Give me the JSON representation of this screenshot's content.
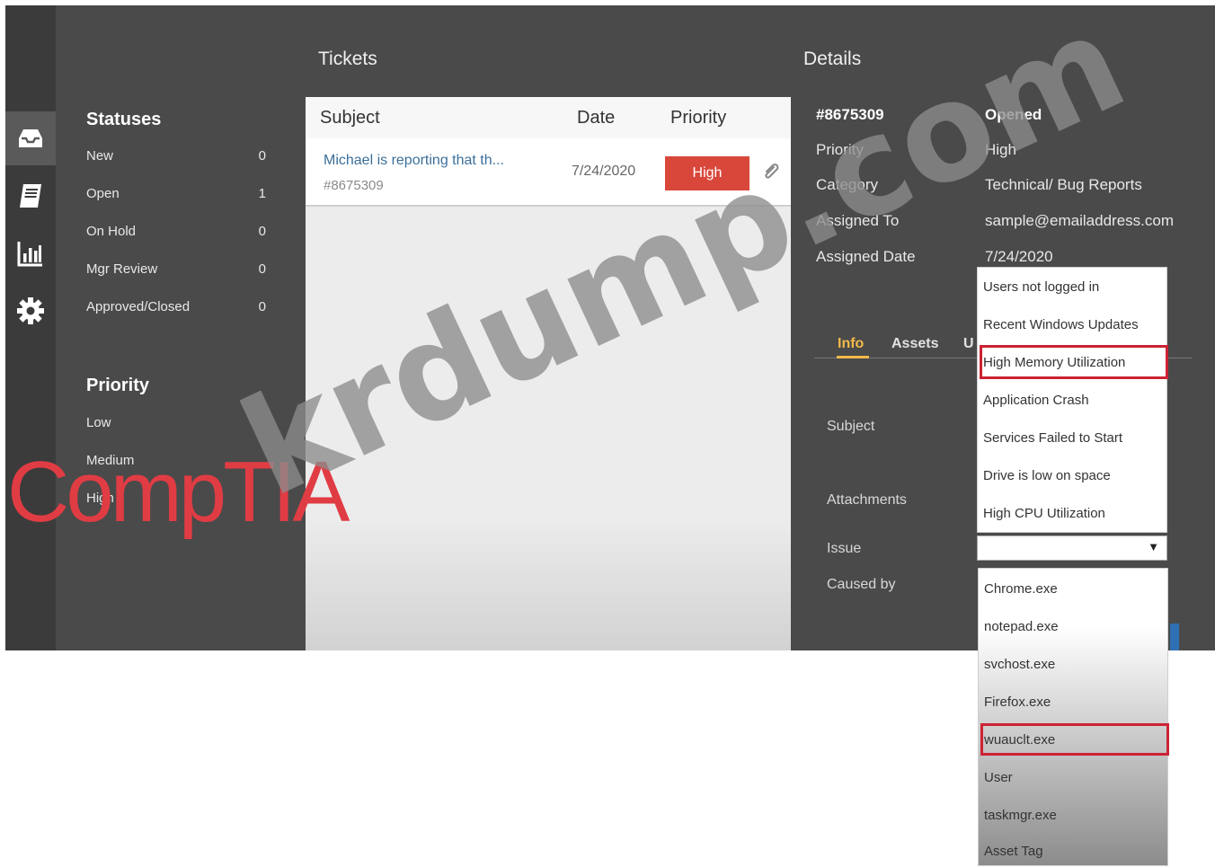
{
  "sidebar": {
    "icons": [
      "inbox-icon",
      "book-icon",
      "chart-icon",
      "gear-icon"
    ],
    "statuses_heading": "Statuses",
    "statuses": [
      {
        "label": "New",
        "count": "0"
      },
      {
        "label": "Open",
        "count": "1"
      },
      {
        "label": "On Hold",
        "count": "0"
      },
      {
        "label": "Mgr Review",
        "count": "0"
      },
      {
        "label": "Approved/Closed",
        "count": "0"
      }
    ],
    "priority_heading": "Priority",
    "priorities": [
      "Low",
      "Medium",
      "High"
    ]
  },
  "tickets": {
    "title": "Tickets",
    "columns": {
      "subject": "Subject",
      "date": "Date",
      "priority": "Priority"
    },
    "row": {
      "subject": "Michael is reporting that th...",
      "id": "#8675309",
      "date": "7/24/2020",
      "priority": "High"
    }
  },
  "details": {
    "title": "Details",
    "ticket_id": "#8675309",
    "opened_label": "Opened",
    "fields": [
      {
        "label": "Priority",
        "value": "High"
      },
      {
        "label": "Category",
        "value": "Technical/ Bug Reports"
      },
      {
        "label": "Assigned To",
        "value": "sample@emailaddress.com"
      },
      {
        "label": "Assigned Date",
        "value": "7/24/2020"
      }
    ],
    "tabs": [
      "Info",
      "Assets",
      "U"
    ],
    "form_labels": {
      "subject": "Subject",
      "attachments": "Attachments",
      "issue": "Issue",
      "caused_by": "Caused by"
    },
    "issue_dropdown": {
      "options": [
        "Users not logged in",
        "Recent Windows Updates",
        "High Memory Utilization",
        "Application Crash",
        "Services Failed to Start",
        "Drive is low on space",
        "High CPU Utilization"
      ],
      "selected": "High Memory Utilization",
      "current_value": ""
    },
    "caused_by_dropdown": {
      "options": [
        "Chrome.exe",
        "notepad.exe",
        "svchost.exe",
        "Firefox.exe",
        "wuauclt.exe",
        "User",
        "taskmgr.exe",
        "Asset Tag"
      ],
      "selected": "wuauclt.exe"
    }
  },
  "watermarks": {
    "brand": "CompTIA",
    "site": "krdump.com"
  },
  "colors": {
    "background": "#4a4a4a",
    "rail": "#3b3b3b",
    "accent": "#f3b94a",
    "priority_high": "#d9473b",
    "selection_outline": "#cc2233",
    "link": "#3b6f9a"
  }
}
